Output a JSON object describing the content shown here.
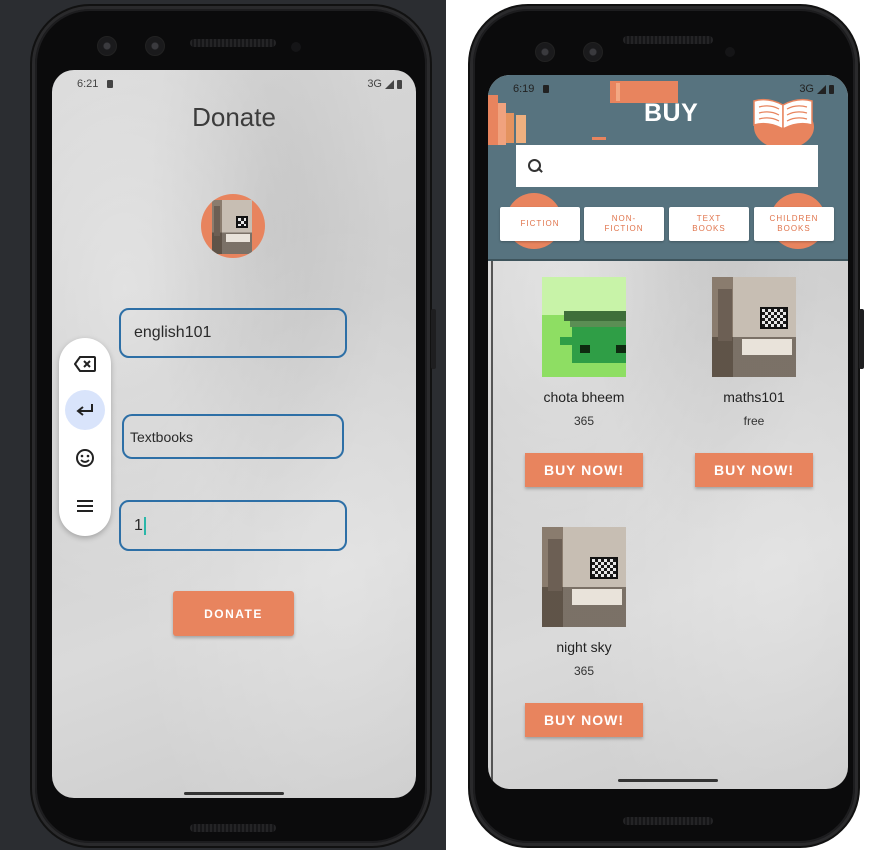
{
  "left_screen": {
    "status": {
      "time": "6:21",
      "network": "3G"
    },
    "title": "Donate",
    "fields": {
      "book_name": "english101",
      "category": "Textbooks",
      "quantity": "1"
    },
    "donate_label": "DONATE"
  },
  "right_screen": {
    "status": {
      "time": "6:19",
      "network": "3G"
    },
    "header_title": "BUY",
    "search_placeholder": "",
    "categories": [
      {
        "label": "FICTION"
      },
      {
        "label": "NON-\nFICTION"
      },
      {
        "label": "TEXT\nBOOKS"
      },
      {
        "label": "CHILDREN\nBOOKS"
      }
    ],
    "books": [
      {
        "name": "chota bheem",
        "price": "365",
        "buy_label": "BUY NOW!"
      },
      {
        "name": "maths101",
        "price": "free",
        "buy_label": "BUY NOW!"
      },
      {
        "name": "night sky",
        "price": "365",
        "buy_label": "BUY NOW!"
      }
    ]
  },
  "colors": {
    "accent": "#e8845e",
    "field_border": "#2d6fa6",
    "header": "#57737f"
  },
  "icons": {
    "keyboard": [
      "backspace-icon",
      "enter-icon",
      "emoji-icon",
      "menu-icon"
    ],
    "search": "search-icon"
  }
}
